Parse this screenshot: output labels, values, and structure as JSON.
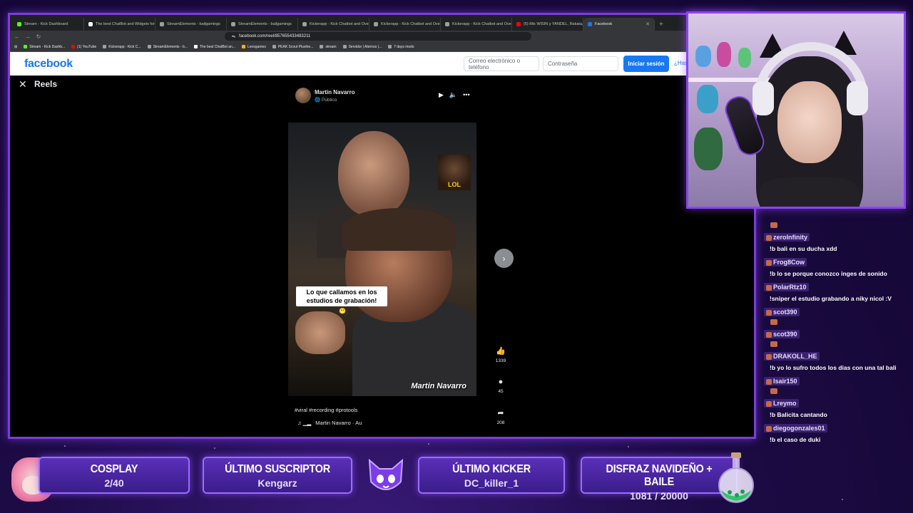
{
  "browser": {
    "tabs": [
      {
        "label": "Stream - Kick Dashboard",
        "color": "#53fc18"
      },
      {
        "label": "The best ChatBot and Widgets for K...",
        "color": "#ffffff"
      },
      {
        "label": "StreamElements - bailgamings",
        "color": "#9aa0a6"
      },
      {
        "label": "StreamElements - bailgamings",
        "color": "#9aa0a6"
      },
      {
        "label": "Kickerapp - Kick Chatbot and Overl...",
        "color": "#9aa0a6"
      },
      {
        "label": "Kickerapp - Kick Chatbot and Overl...",
        "color": "#9aa0a6"
      },
      {
        "label": "Kickerapp - Kick Chatbot and Overl...",
        "color": "#9aa0a6"
      },
      {
        "label": "(5) Mix WISIN y YANDEL, Rakata, Pe...",
        "color": "#ff0000"
      },
      {
        "label": "Facebook",
        "color": "#1877f2",
        "active": true
      }
    ],
    "new_tab": "+",
    "url": "facebook.com/reel/857655433483211",
    "bookmarks": [
      {
        "label": "Stream - Kick Dashb...",
        "color": "#53fc18"
      },
      {
        "label": "(1) YouTube",
        "color": "#ff0000"
      },
      {
        "label": "Kickerapp - Kick C...",
        "color": "#9aa0a6"
      },
      {
        "label": "StreamElements - b...",
        "color": "#9aa0a6"
      },
      {
        "label": "The best ChatBot an...",
        "color": "#ffffff"
      },
      {
        "label": "Leoxgames",
        "color": "#f4b400"
      },
      {
        "label": "PEAK Scout Plushie...",
        "color": "#9aa0a6"
      },
      {
        "label": "stream",
        "color": "#9aa0a6"
      },
      {
        "label": "Servidor | Aternos |...",
        "color": "#9aa0a6"
      },
      {
        "label": "7 days mods",
        "color": "#9aa0a6"
      }
    ]
  },
  "facebook": {
    "logo": "facebook",
    "email_placeholder": "Correo electrónico o teléfono",
    "password_placeholder": "Contraseña",
    "login_button": "Iniciar sesión",
    "forgot_link": "¿Has",
    "reels_title": "Reels",
    "author": "Martin Navarro",
    "privacy": "Público",
    "lol_sticker": "LOL",
    "caption": "Lo que callamos en los estudios de grabación!",
    "caption_emoji": "😬",
    "video_watermark": "Martin Navarro",
    "hashtags": "#viral #recording #protools",
    "audio": "Martin Navarro · Au",
    "likes": "1339",
    "comments": "45",
    "shares": "208"
  },
  "chat": [
    {
      "user": "",
      "text": "",
      "emote": true
    },
    {
      "user": "zeroInfinity",
      "text": "!b bali en su ducha xdd"
    },
    {
      "user": "Frog8Cow",
      "text": "!b lo se porque conozco inges de sonido"
    },
    {
      "user": "PolarRtz10",
      "text": "!sniper el estudio grabando a niky nicol :V"
    },
    {
      "user": "scot390",
      "text": "",
      "emote": true
    },
    {
      "user": "scot390",
      "text": "",
      "emote": true
    },
    {
      "user": "DRAKOLL_HE",
      "text": "!b yo lo sufro todos los dias con una tal bali"
    },
    {
      "user": "Isair150",
      "text": "",
      "emote": true
    },
    {
      "user": "Lreymo",
      "text": "!b Balicita cantando"
    },
    {
      "user": "diegogonzales01",
      "text": "!b el caso de duki"
    }
  ],
  "overlay": {
    "cosplay_title": "COSPLAY",
    "cosplay_value": "2/40",
    "sub_title": "ÚLTIMO SUSCRIPTOR",
    "sub_value": "Kengarz",
    "kicker_title": "ÚLTIMO KICKER",
    "kicker_value": "DC_killer_1",
    "goal_title": "DISFRAZ NAVIDEÑO + BAILE",
    "goal_value": "1081 / 20000"
  },
  "colors": {
    "frame": "#7d3be0",
    "facebook_blue": "#1877f2",
    "panel": "#3a1d8a"
  }
}
